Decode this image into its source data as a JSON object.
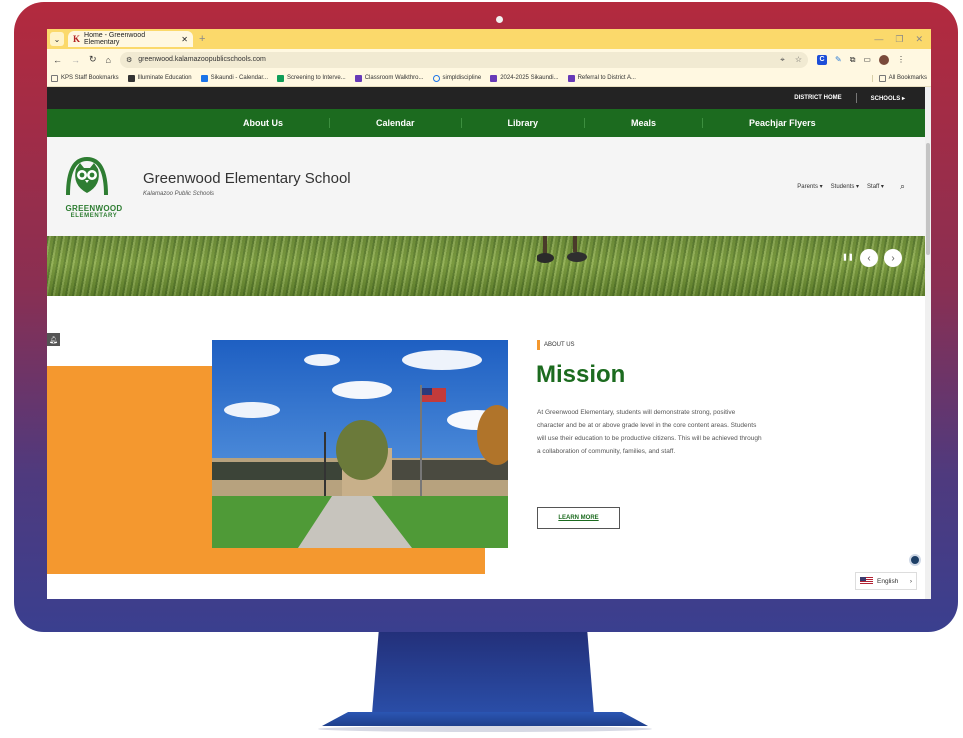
{
  "browser": {
    "tab_title": "Home - Greenwood Elementary",
    "tab_favicon": "K",
    "url": "greenwood.kalamazoopublicschools.com",
    "bookmarks": [
      "KPS Staff Bookmarks",
      "Illuminate Education",
      "Sikaundi - Calendar...",
      "Screening to Interve...",
      "Classroom Walkthro...",
      "simpldiscipline",
      "2024-2025 Sikaundi...",
      "Referral to District A..."
    ],
    "all_bookmarks": "All Bookmarks",
    "extension_letter": "C"
  },
  "site": {
    "topbar": {
      "district_home": "DISTRICT HOME",
      "schools": "SCHOOLS ▸"
    },
    "nav": [
      "About Us",
      "Calendar",
      "Library",
      "Meals",
      "Peachjar Flyers"
    ],
    "header": {
      "logo_line1": "GREENWOOD",
      "logo_line2": "ELEMENTARY",
      "school_name": "Greenwood Elementary School",
      "district": "Kalamazoo Public Schools",
      "menu": [
        "Parents ▾",
        "Students ▾",
        "Staff ▾"
      ]
    },
    "about": {
      "tag": "ABOUT US",
      "heading": "Mission",
      "text": "At Greenwood Elementary, students will demonstrate strong, positive character and be at or above grade level in the core content areas. Students will use their education to be productive citizens. This will be achieved through a collaboration of community, families, and staff.",
      "button": "LEARN MORE"
    },
    "language": "English"
  },
  "colors": {
    "nav_green": "#1c6b1f",
    "accent_orange": "#f4982f",
    "topbar_dark": "#232323",
    "monitor_top": "#b32a3e",
    "monitor_bottom": "#3a3f8f"
  }
}
